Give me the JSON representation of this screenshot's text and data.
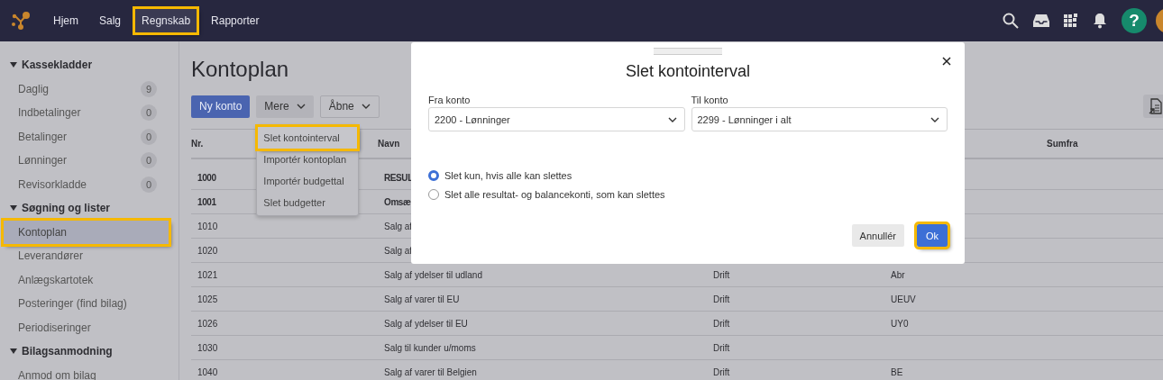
{
  "topbar": {
    "nav": [
      {
        "label": "Hjem",
        "highlighted": false
      },
      {
        "label": "Salg",
        "highlighted": false
      },
      {
        "label": "Regnskab",
        "highlighted": true
      },
      {
        "label": "Rapporter",
        "highlighted": false
      }
    ],
    "help": "?"
  },
  "sidebar": {
    "sections": [
      {
        "title": "Kassekladder",
        "expanded": true,
        "children": [
          {
            "label": "Daglig",
            "count": "9",
            "selected": false,
            "highlighted": false
          },
          {
            "label": "Indbetalinger",
            "count": "0",
            "selected": false,
            "highlighted": false
          },
          {
            "label": "Betalinger",
            "count": "0",
            "selected": false,
            "highlighted": false
          },
          {
            "label": "Lønninger",
            "count": "0",
            "selected": false,
            "highlighted": false
          },
          {
            "label": "Revisorkladde",
            "count": "0",
            "selected": false,
            "highlighted": false
          }
        ]
      },
      {
        "title": "Søgning og lister",
        "expanded": true,
        "children": [
          {
            "label": "Kontoplan",
            "selected": true,
            "highlighted": true
          },
          {
            "label": "Leverandører",
            "selected": false,
            "highlighted": false
          },
          {
            "label": "Anlægskartotek",
            "selected": false,
            "highlighted": false
          },
          {
            "label": "Posteringer (find bilag)",
            "selected": false,
            "highlighted": false
          },
          {
            "label": "Periodiseringer",
            "selected": false,
            "highlighted": false
          }
        ]
      },
      {
        "title": "Bilagsanmodning",
        "expanded": true,
        "children": [
          {
            "label": "Anmod om bilag",
            "selected": false,
            "highlighted": false
          }
        ]
      }
    ]
  },
  "page": {
    "title": "Kontoplan",
    "buttons": [
      {
        "label": "Ny konto",
        "kind": "primary"
      },
      {
        "label": "Mere",
        "kind": "menu"
      },
      {
        "label": "Åbne",
        "kind": "outline"
      }
    ],
    "menu": [
      {
        "label": "Slet kontointerval",
        "highlighted": true
      },
      {
        "label": "Importér kontoplan",
        "highlighted": false
      },
      {
        "label": "Importér budgettal",
        "highlighted": false
      },
      {
        "label": "Slet budgetter",
        "highlighted": false
      }
    ]
  },
  "table": {
    "header": {
      "nr": "Nr.",
      "navn": "Navn",
      "sumfra": "Sumfra"
    },
    "rows": [
      {
        "nr": "1000",
        "navn": "RESUL",
        "bold": true
      },
      {
        "nr": "1001",
        "navn": "Omsæ",
        "bold": true
      },
      {
        "nr": "1010",
        "navn": "Salg af",
        "bold": false
      },
      {
        "nr": "1020",
        "navn": "Salg af",
        "bold": false
      },
      {
        "nr": "1021",
        "navn": "Salg af ydelser til udland",
        "column_3": "Drift",
        "column_4": "Abr",
        "bold": false
      },
      {
        "nr": "1025",
        "navn": "Salg af varer til EU",
        "column_3": "Drift",
        "column_4": "UEUV",
        "bold": false
      },
      {
        "nr": "1026",
        "navn": "Salg af ydelser til EU",
        "column_3": "Drift",
        "column_4": "UY0",
        "bold": false
      },
      {
        "nr": "1030",
        "navn": "Salg til kunder u/moms",
        "column_3": "Drift",
        "bold": false
      },
      {
        "nr": "1040",
        "navn": "Salg af varer til Belgien",
        "column_3": "Drift",
        "column_4": "BE",
        "bold": false
      }
    ]
  },
  "dialog": {
    "title": "Slet kontointerval",
    "fields": [
      {
        "label": "Fra konto",
        "value": "2200 - Lønninger"
      },
      {
        "label": "Til konto",
        "value": "2299 - Lønninger i alt"
      }
    ],
    "options": [
      {
        "label": "Slet kun, hvis alle kan slettes",
        "selected": true
      },
      {
        "label": "Slet alle resultat- og balancekonti, som kan slettes",
        "selected": false
      }
    ],
    "buttons": [
      {
        "label": "Annullér",
        "kind": "secondary",
        "highlighted": false
      },
      {
        "label": "Ok",
        "kind": "primary",
        "highlighted": true
      }
    ]
  }
}
